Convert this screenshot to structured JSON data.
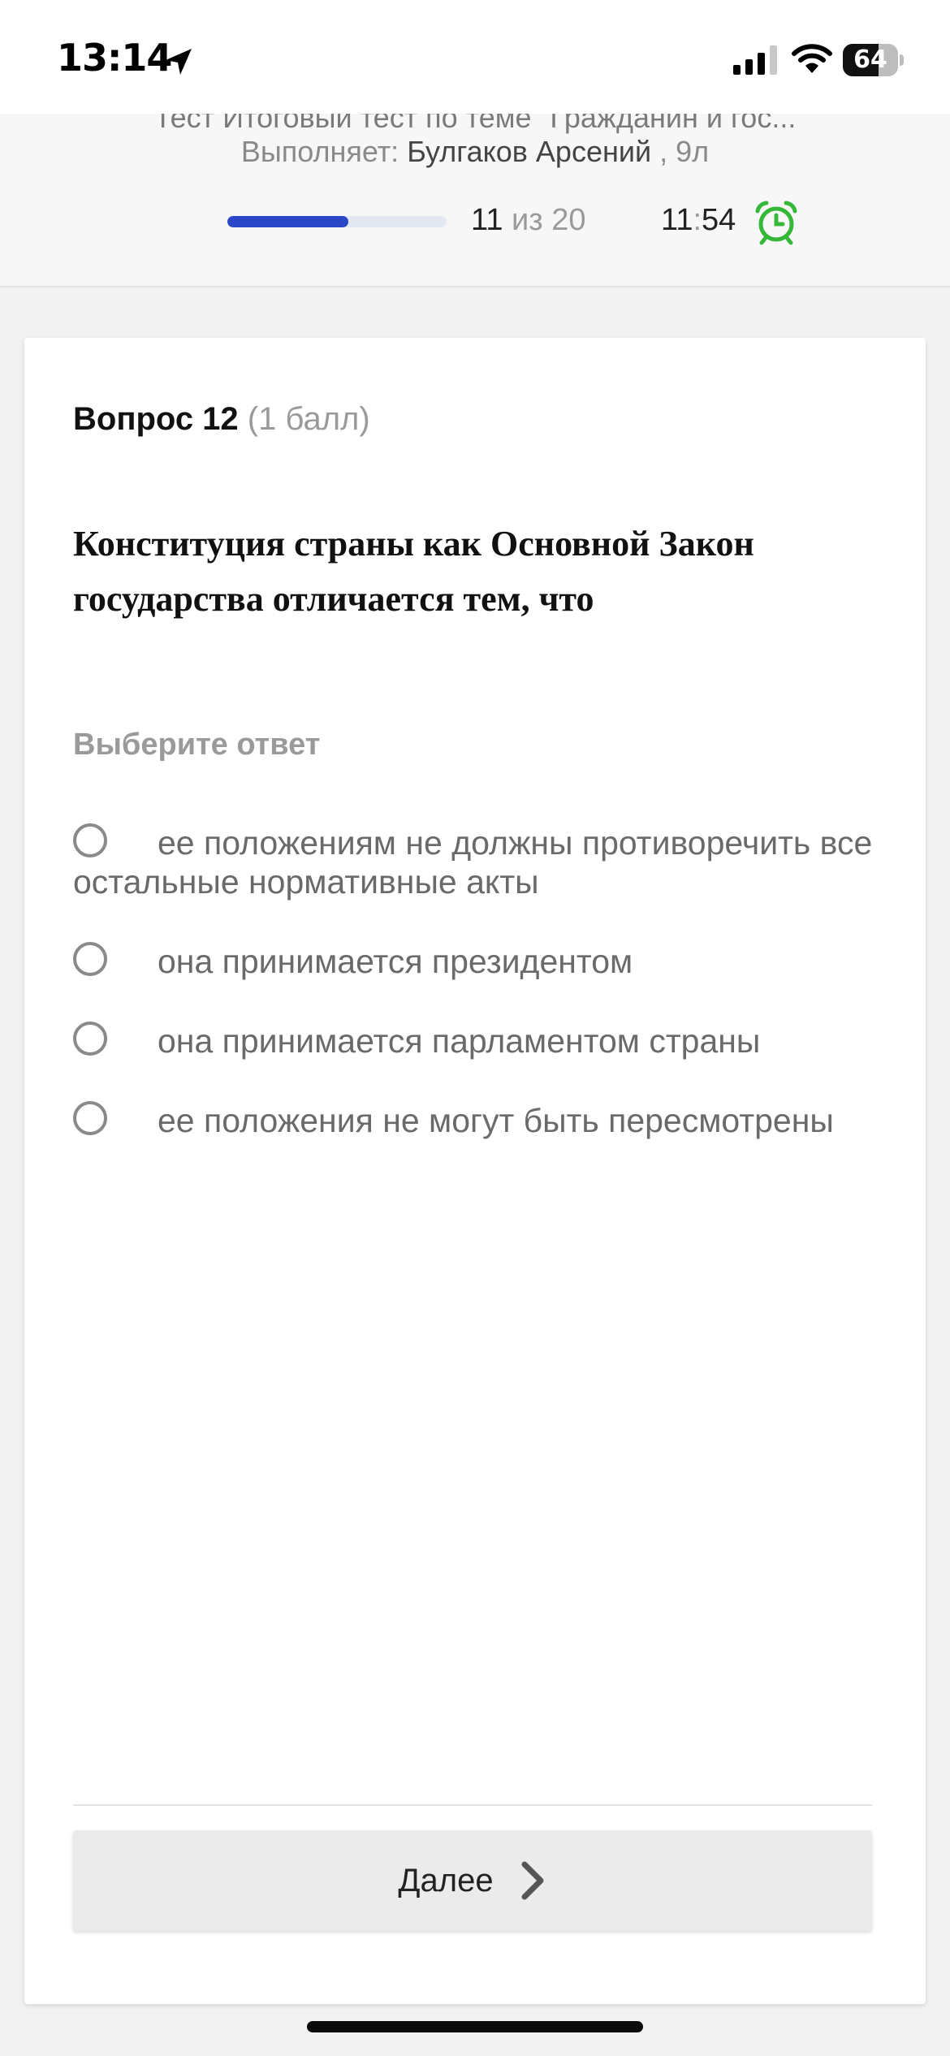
{
  "status_bar": {
    "time": "13:14",
    "battery_level": "64",
    "battery_fraction": 0.64
  },
  "header": {
    "test_title": "Тест Итоговый тест по теме \"Гражданин и гос...",
    "performer_label": "Выполняет:",
    "performer_name": "Булгаков Арсений",
    "performer_class": ", 9л",
    "progress_current": "11",
    "progress_separator": "из",
    "progress_total": "20",
    "progress_fraction": 0.55,
    "timer_minutes": "11",
    "timer_colon": ":",
    "timer_seconds": "54",
    "timer_icon": "alarm-clock-icon",
    "accent_color": "#2a47c8",
    "timer_color": "#35b83a"
  },
  "question": {
    "label": "Вопрос 12",
    "points": "(1 балл)",
    "text": "Конституция страны как Основной Закон государства отличается тем, что",
    "answer_prompt": "Выберите ответ",
    "options": [
      {
        "label": "ее положениям не должны противоречить все остальные нормативные акты"
      },
      {
        "label": "она принимается президентом"
      },
      {
        "label": "она принимается парламентом страны"
      },
      {
        "label": "ее положения не могут быть пересмотрены"
      }
    ]
  },
  "footer": {
    "next_label": "Далее"
  }
}
